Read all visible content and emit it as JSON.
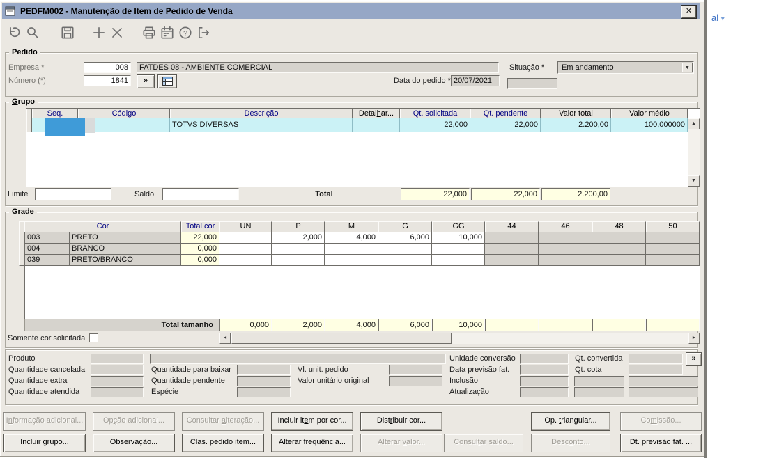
{
  "backdrop": {
    "link_text": "al",
    "caret": "▾"
  },
  "window": {
    "title": "PEDFM002 - Manutenção de Item de Pedido de Venda",
    "close_glyph": "✕"
  },
  "toolbar": {
    "help_glyph": "?"
  },
  "scroll": {
    "up": "▲",
    "down": "▼",
    "left": "◄",
    "right": "►"
  },
  "pedido": {
    "legend": "Pedido",
    "empresa_label": "Empresa *",
    "empresa_value": "008",
    "empresa_desc": "FATDES 08 - AMBIENTE COMERCIAL",
    "numero_label": "Número (*)",
    "numero_value": "1841",
    "more_glyph": "»",
    "data_label": "Data do pedido *",
    "data_value": "20/07/2021",
    "situacao_label": "Situação *",
    "situacao_value": "Em andamento"
  },
  "grupo": {
    "legend_pre": "",
    "legend_key": "G",
    "legend_post": "rupo",
    "col_seq": "Seq.",
    "col_codigo": "Código",
    "col_descricao": "Descrição",
    "col_detalhar_pre": "Detal",
    "col_detalhar_key": "h",
    "col_detalhar_post": "ar...",
    "col_qt_solicitada": "Qt. solicitada",
    "col_qt_pendente": "Qt. pendente",
    "col_valor_total": "Valor total",
    "col_valor_medio": "Valor médio",
    "row": {
      "descricao": "TOTVS DIVERSAS",
      "qt_solicitada": "22,000",
      "qt_pendente": "22,000",
      "valor_total": "2.200,00",
      "valor_medio": "100,000000"
    },
    "limite_label": "Limite",
    "saldo_label": "Saldo",
    "total_label": "Total",
    "total_qt_solicitada": "22,000",
    "total_qt_pendente": "22,000",
    "total_valor": "2.200,00"
  },
  "grade": {
    "legend": "Grade",
    "col_cor": "Cor",
    "col_total_cor": "Total cor",
    "size_cols": [
      "UN",
      "P",
      "M",
      "G",
      "GG",
      "44",
      "46",
      "48",
      "50"
    ],
    "rows": [
      {
        "codigo": "003",
        "cor": "PRETO",
        "total": "22,000",
        "sizes": [
          "",
          "2,000",
          "4,000",
          "6,000",
          "10,000",
          "",
          "",
          "",
          ""
        ]
      },
      {
        "codigo": "004",
        "cor": "BRANCO",
        "total": "0,000",
        "sizes": [
          "",
          "",
          "",
          "",
          "",
          "",
          "",
          "",
          ""
        ]
      },
      {
        "codigo": "039",
        "cor": "PRETO/BRANCO",
        "total": "0,000",
        "sizes": [
          "",
          "",
          "",
          "",
          "",
          "",
          "",
          "",
          ""
        ]
      }
    ],
    "total_label": "Total tamanho",
    "totals": [
      "0,000",
      "2,000",
      "4,000",
      "6,000",
      "10,000",
      "",
      "",
      "",
      ""
    ],
    "checkbox_label": "Somente cor solicitada"
  },
  "detail": {
    "produto": "Produto",
    "qtd_cancelada": "Quantidade cancelada",
    "qtd_extra": "Quantidade extra",
    "qtd_atendida": "Quantidade atendida",
    "qtd_para_baixar": "Quantidade para baixar",
    "qtd_pendente": "Quantidade pendente",
    "especie": "Espécie",
    "vl_unit_pedido": "Vl. unit. pedido",
    "valor_unitario_original": "Valor unitário original",
    "unidade_conversao": "Unidade conversão",
    "data_previsao_fat": "Data previsão fat.",
    "inclusao": "Inclusão",
    "atualizacao": "Atualização",
    "qt_convertida": "Qt. convertida",
    "qt_cota": "Qt. cota",
    "more_glyph": "»"
  },
  "buttons": {
    "info_adicional": {
      "pre": "I",
      "key": "n",
      "post": "formação adicional..."
    },
    "opcao_adicional": {
      "pre": "Op",
      "key": "ç",
      "post": "ão adicional..."
    },
    "consultar_alteracao": {
      "pre": "Consultar ",
      "key": "a",
      "post": "lteração..."
    },
    "incluir_item_por_cor": {
      "pre": "Incluir it",
      "key": "e",
      "post": "m por cor..."
    },
    "distribuir_cor": {
      "pre": "Dist",
      "key": "r",
      "post": "ibuir cor..."
    },
    "op_triangular": {
      "pre": "Op. ",
      "key": "t",
      "post": "riangular..."
    },
    "comissao": {
      "pre": "Co",
      "key": "m",
      "post": "issão..."
    },
    "incluir_grupo": {
      "pre": "",
      "key": "I",
      "post": "ncluir grupo..."
    },
    "observacao": {
      "pre": "O",
      "key": "b",
      "post": "servação..."
    },
    "clas_pedido_item": {
      "pre": "",
      "key": "C",
      "post": "las. pedido item..."
    },
    "alterar_frequencia": {
      "pre": "Alterar fre",
      "key": "q",
      "post": "uência..."
    },
    "alterar_valor": {
      "pre": "Alterar ",
      "key": "v",
      "post": "alor..."
    },
    "consultar_saldo": {
      "pre": "Consul",
      "key": "t",
      "post": "ar saldo..."
    },
    "desconto": {
      "pre": "Desc",
      "key": "o",
      "post": "nto..."
    },
    "dt_previsao_fat": {
      "pre": "Dt. previsão ",
      "key": "f",
      "post": "at. ..."
    }
  }
}
